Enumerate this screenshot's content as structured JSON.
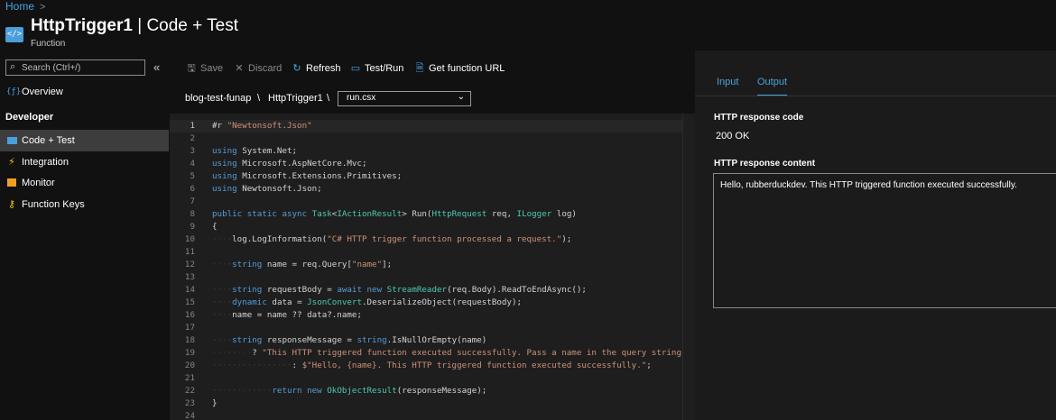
{
  "header": {
    "breadcrumb": "Home",
    "breadcrumb_sep": ">",
    "icon_text": "</>",
    "title_bold": "HttpTrigger1",
    "title_rest": " | Code + Test",
    "subtitle": "Function"
  },
  "sidebar": {
    "search_placeholder": "Search (Ctrl+/)",
    "collapse": "«",
    "overview": "Overview",
    "section": "Developer",
    "items": [
      {
        "label": "Code + Test",
        "icon": "code-test-icon"
      },
      {
        "label": "Integration",
        "icon": "lightning-icon"
      },
      {
        "label": "Monitor",
        "icon": "monitor-icon"
      },
      {
        "label": "Function Keys",
        "icon": "key-icon"
      }
    ]
  },
  "toolbar": {
    "save": "Save",
    "discard": "Discard",
    "refresh": "Refresh",
    "test_run": "Test/Run",
    "get_url": "Get function URL"
  },
  "path": {
    "app": "blog-test-funap",
    "sep": "\\",
    "function": "HttpTrigger1",
    "file": "run.csx"
  },
  "editor": {
    "lines": [
      "1",
      "2",
      "3",
      "4",
      "5",
      "6",
      "7",
      "8",
      "9",
      "10",
      "11",
      "12",
      "13",
      "14",
      "15",
      "16",
      "17",
      "18",
      "19",
      "20",
      "21",
      "22",
      "23",
      "24"
    ]
  },
  "output_panel": {
    "tabs": [
      "Input",
      "Output"
    ],
    "active_tab": "Output",
    "code_label": "HTTP response code",
    "code_value": "200 OK",
    "content_label": "HTTP response content",
    "content_value": "Hello, rubberduckdev. This HTTP triggered function executed successfully."
  },
  "colors": {
    "accent": "#4aa3df",
    "keyword": "#569cd6",
    "string": "#ce9178",
    "type": "#4ec9b0"
  }
}
